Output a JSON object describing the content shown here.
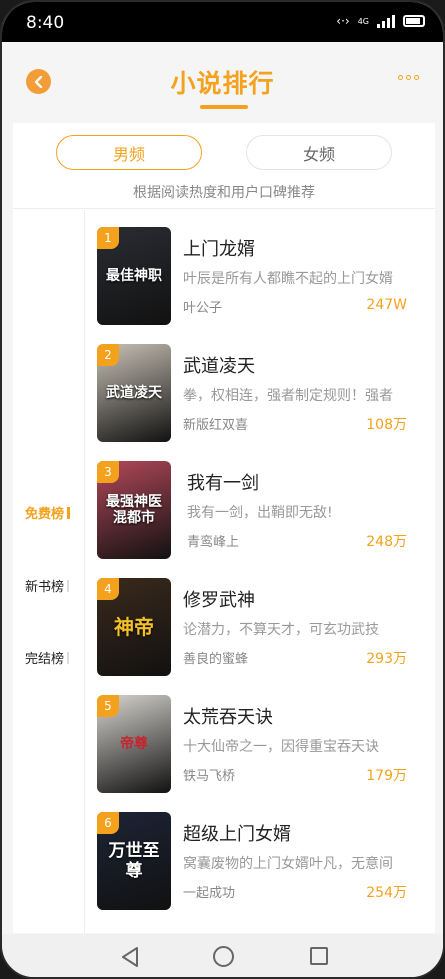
{
  "status_bar": {
    "time": "8:40",
    "network": "4G"
  },
  "header": {
    "title": "小说排行"
  },
  "tabs": [
    {
      "label": "男频",
      "active": true
    },
    {
      "label": "女频",
      "active": false
    }
  ],
  "tab_hint": "根据阅读热度和用户口碑推荐",
  "side_nav": [
    {
      "label": "免费榜",
      "active": true
    },
    {
      "label": "新书榜",
      "active": false
    },
    {
      "label": "完结榜",
      "active": false
    }
  ],
  "books": [
    {
      "rank": "1",
      "title": "上门龙婿",
      "desc": "叶辰是所有人都瞧不起的上门女婿",
      "author": "叶公子",
      "count": "247W",
      "cover_text": "最佳神职",
      "cover_color": "#2b2d33"
    },
    {
      "rank": "2",
      "title": "武道凌天",
      "desc": "拳，权相连，强者制定规则！强者",
      "author": "新版红双喜",
      "count": "108万",
      "cover_text": "武道凌天",
      "cover_color": "#c9c2b6"
    },
    {
      "rank": "3",
      "title": "我有一剑",
      "desc": "我有一剑，出鞘即无敌!",
      "author": "青鸾峰上",
      "count": "248万",
      "cover_text": "最强神医混都市",
      "cover_color": "#b3485a"
    },
    {
      "rank": "4",
      "title": "修罗武神",
      "desc": "论潜力，不算天才，可玄功武技",
      "author": "善良的蜜蜂",
      "count": "293万",
      "cover_text": "神帝",
      "cover_color": "#3b2a1c"
    },
    {
      "rank": "5",
      "title": "太荒吞天诀",
      "desc": "十大仙帝之一，因得重宝吞天诀",
      "author": "铁马飞桥",
      "count": "179万",
      "cover_text": "帝尊",
      "cover_color": "#d8d5d0"
    },
    {
      "rank": "6",
      "title": "超级上门女婿",
      "desc": "窝囊废物的上门女婿叶凡，无意间",
      "author": "一起成功",
      "count": "254万",
      "cover_text": "万世至尊",
      "cover_color": "#1d2436"
    }
  ]
}
